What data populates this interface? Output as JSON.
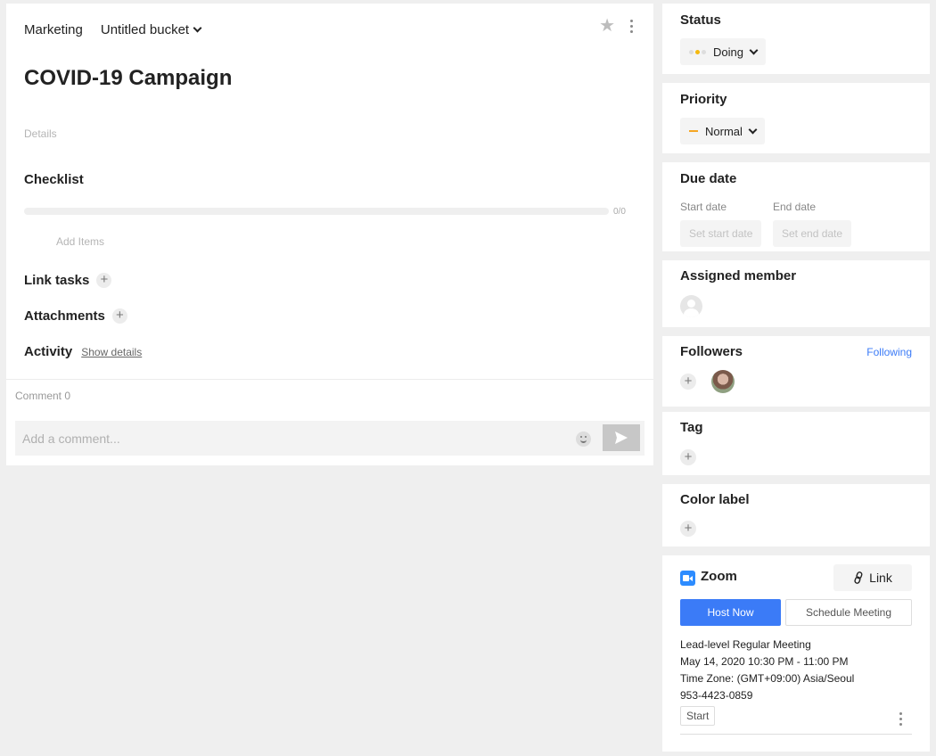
{
  "breadcrumb": {
    "project": "Marketing",
    "bucket": "Untitled bucket"
  },
  "task": {
    "title": "COVID-19 Campaign",
    "details_placeholder": "Details",
    "checklist_heading": "Checklist",
    "checklist_progress": "0/0",
    "checklist_fraction": 0,
    "add_items": "Add Items",
    "link_tasks": "Link tasks",
    "attachments": "Attachments",
    "activity": "Activity",
    "show_details": "Show details"
  },
  "comments": {
    "count_label": "Comment 0",
    "placeholder": "Add a comment..."
  },
  "status": {
    "heading": "Status",
    "value": "Doing"
  },
  "priority": {
    "heading": "Priority",
    "value": "Normal"
  },
  "due_date": {
    "heading": "Due date",
    "start_label": "Start date",
    "end_label": "End date",
    "start_placeholder": "Set start date",
    "end_placeholder": "Set end date"
  },
  "assigned": {
    "heading": "Assigned member"
  },
  "followers": {
    "heading": "Followers",
    "following_label": "Following"
  },
  "tag": {
    "heading": "Tag"
  },
  "color_label": {
    "heading": "Color label"
  },
  "zoom": {
    "title": "Zoom",
    "link_label": "Link",
    "host_now": "Host Now",
    "schedule_meeting": "Schedule Meeting",
    "meeting_name": "Lead-level Regular Meeting",
    "meeting_time": "May 14, 2020 10:30 PM - 11:00 PM",
    "time_zone": "Time Zone: (GMT+09:00) Asia/Seoul",
    "meeting_id": "953-4423-0859",
    "start_label": "Start"
  },
  "colors": {
    "accent": "#3b7bf7",
    "status_dot": "#f5b90f",
    "priority_dash": "#f5a623",
    "zoom": "#2d8cff"
  }
}
